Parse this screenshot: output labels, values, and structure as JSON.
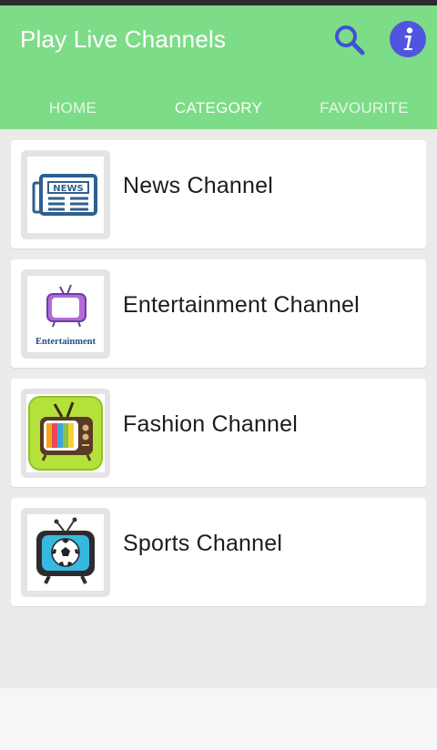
{
  "app": {
    "title": "Play Live Channels",
    "accent_color": "#7ddc87",
    "search_icon": "search-icon",
    "info_icon": "info-icon"
  },
  "tabs": [
    {
      "label": "HOME",
      "active": false
    },
    {
      "label": "CATEGORY",
      "active": true
    },
    {
      "label": "FAVOURITE",
      "active": false
    }
  ],
  "categories": [
    {
      "label": "News Channel",
      "icon": "newspaper-icon",
      "icon_text": "NEWS"
    },
    {
      "label": "Entertainment Channel",
      "icon": "tv-entertainment-icon",
      "icon_text": "Entertainment"
    },
    {
      "label": "Fashion Channel",
      "icon": "retro-tv-icon"
    },
    {
      "label": "Sports Channel",
      "icon": "soccer-tv-icon"
    }
  ]
}
